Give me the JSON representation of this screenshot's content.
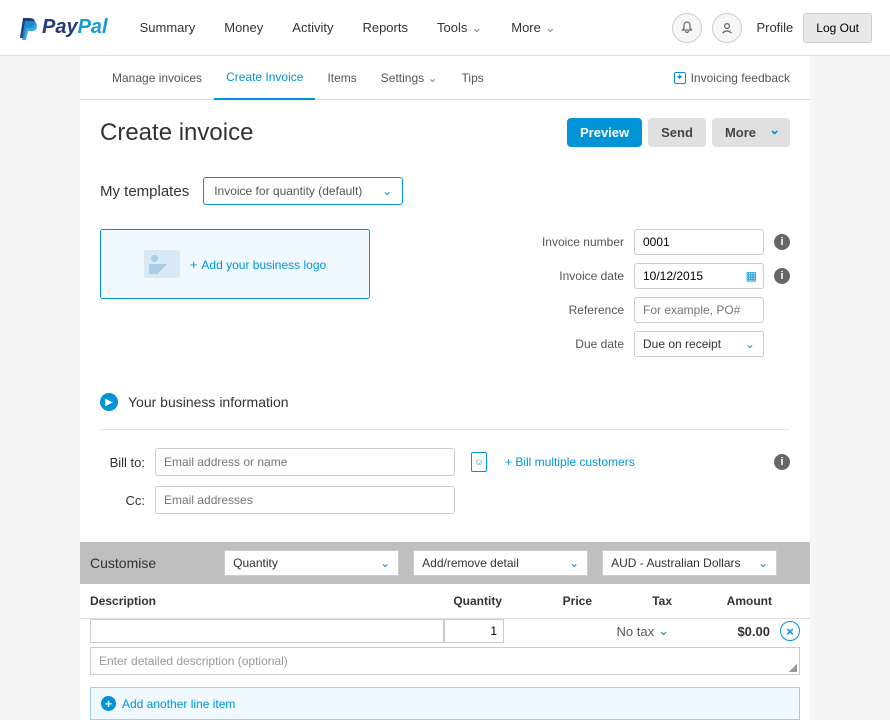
{
  "header": {
    "brand1": "Pay",
    "brand2": "Pal",
    "nav": [
      "Summary",
      "Money",
      "Activity",
      "Reports",
      "Tools",
      "More"
    ],
    "profile": "Profile",
    "logout": "Log Out"
  },
  "subnav": {
    "items": [
      "Manage invoices",
      "Create Invoice",
      "Items",
      "Settings",
      "Tips"
    ],
    "feedback": "Invoicing feedback"
  },
  "title": "Create invoice",
  "buttons": {
    "preview": "Preview",
    "send": "Send",
    "more": "More"
  },
  "templates": {
    "label": "My templates",
    "selected": "Invoice for quantity (default)"
  },
  "logoBox": "Add your business logo",
  "meta": {
    "invoiceNumber": {
      "label": "Invoice number",
      "value": "0001"
    },
    "invoiceDate": {
      "label": "Invoice date",
      "value": "10/12/2015"
    },
    "reference": {
      "label": "Reference",
      "placeholder": "For example, PO#"
    },
    "dueDate": {
      "label": "Due date",
      "value": "Due on receipt"
    }
  },
  "bizInfo": "Your business information",
  "billTo": {
    "label": "Bill to:",
    "placeholder": "Email address or name",
    "multi": "+ Bill multiple customers"
  },
  "cc": {
    "label": "Cc:",
    "placeholder": "Email addresses"
  },
  "customise": {
    "label": "Customise",
    "qty": "Quantity",
    "detail": "Add/remove detail",
    "currency": "AUD - Australian Dollars"
  },
  "cols": {
    "desc": "Description",
    "qty": "Quantity",
    "price": "Price",
    "tax": "Tax",
    "amount": "Amount"
  },
  "line": {
    "qty": "1",
    "tax": "No tax",
    "amount": "$0.00",
    "detailPlaceholder": "Enter detailed description (optional)"
  },
  "addLine": "Add another line item"
}
